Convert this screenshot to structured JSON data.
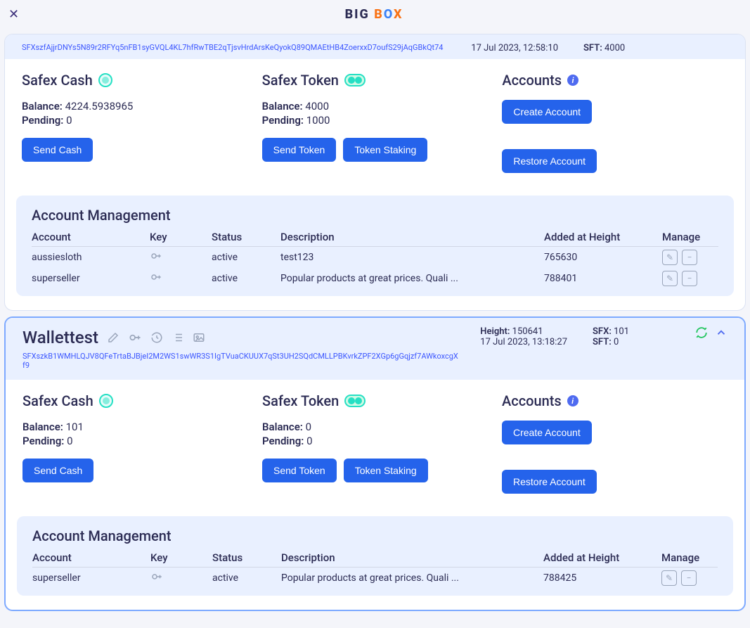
{
  "app": {
    "logo_big": "BIG",
    "logo_b": "B",
    "logo_o": "O",
    "logo_x": "X"
  },
  "labels": {
    "safex_cash": "Safex Cash",
    "safex_token": "Safex Token",
    "accounts": "Accounts",
    "balance": "Balance:",
    "pending": "Pending:",
    "send_cash": "Send Cash",
    "send_token": "Send Token",
    "token_staking": "Token Staking",
    "create_account": "Create Account",
    "restore_account": "Restore Account",
    "acct_mgmt": "Account Management",
    "col_account": "Account",
    "col_key": "Key",
    "col_status": "Status",
    "col_desc": "Description",
    "col_height": "Added at Height",
    "col_manage": "Manage",
    "height": "Height:",
    "sfx": "SFX:",
    "sft": "SFT:"
  },
  "wallets": [
    {
      "address": "SFXszfAjjrDNYs5N89r2RFYq5nFB1syGVQL4KL7hfRwTBE2qTjsvHrdArsKeQyokQ89QMAEtHB4ZoerxxD7oufS29jAqGBkQt74",
      "date": "17 Jul 2023, 12:58:10",
      "sft": "4000",
      "cash_balance": "4224.5938965",
      "cash_pending": "0",
      "token_balance": "4000",
      "token_pending": "1000",
      "accounts": [
        {
          "name": "aussiesloth",
          "status": "active",
          "desc": "test123",
          "height": "765630"
        },
        {
          "name": "superseller",
          "status": "active",
          "desc": "Popular products at great prices. Quali ...",
          "height": "788401"
        }
      ]
    },
    {
      "name": "Wallettest",
      "address": "SFXszkB1WMHLQJV8QFeTrtaBJBjeI2M2WS1swWR3S1IgTVuaCKUUX7qSt3UH2SQdCMLLPBKvrkZPF2XGp6gGqjzf7AWkoxcgXf9",
      "height": "150641",
      "date": "17 Jul 2023, 13:18:27",
      "sfx": "101",
      "sft": "0",
      "cash_balance": "101",
      "cash_pending": "0",
      "token_balance": "0",
      "token_pending": "0",
      "accounts": [
        {
          "name": "superseller",
          "status": "active",
          "desc": "Popular products at great prices. Quali ...",
          "height": "788425"
        }
      ]
    }
  ]
}
